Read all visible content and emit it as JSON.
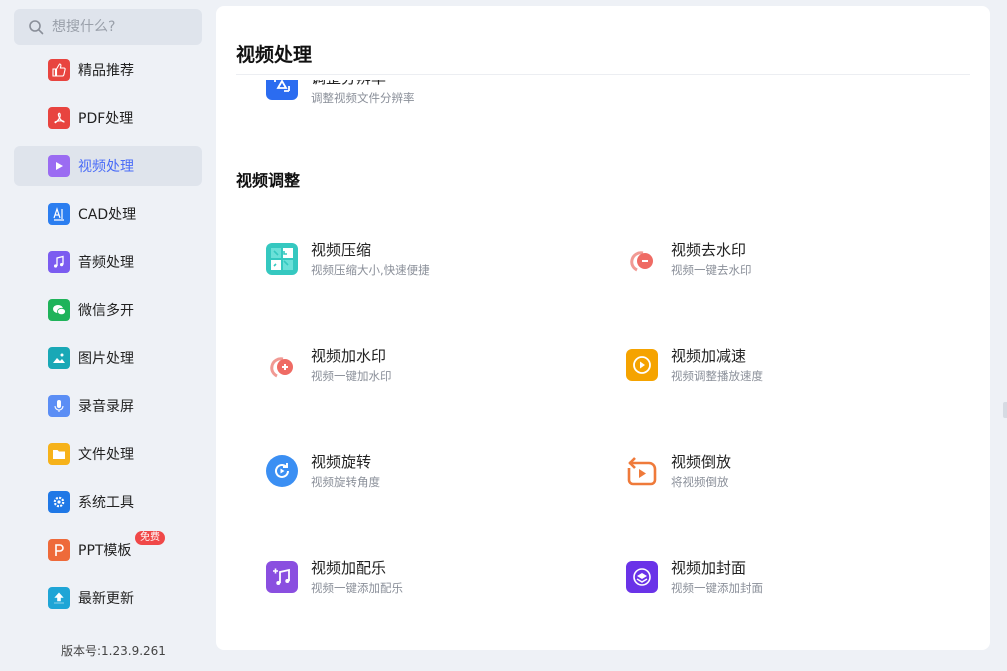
{
  "search": {
    "placeholder": "想搜什么?"
  },
  "sidebar": {
    "items": [
      {
        "label": "精品推荐",
        "icon": "thumbs-up-icon",
        "color": "#e8443f"
      },
      {
        "label": "PDF处理",
        "icon": "pdf-icon",
        "color": "#e8443f"
      },
      {
        "label": "视频处理",
        "icon": "play-icon",
        "color": "#9b6cf2"
      },
      {
        "label": "CAD处理",
        "icon": "cad-icon",
        "color": "#2b7ef0"
      },
      {
        "label": "音频处理",
        "icon": "music-icon",
        "color": "#7b5cf0"
      },
      {
        "label": "微信多开",
        "icon": "wechat-icon",
        "color": "#1fb35a"
      },
      {
        "label": "图片处理",
        "icon": "image-icon",
        "color": "#19a8b6"
      },
      {
        "label": "录音录屏",
        "icon": "microphone-icon",
        "color": "#5b8ef5"
      },
      {
        "label": "文件处理",
        "icon": "folder-icon",
        "color": "#f6b21a"
      },
      {
        "label": "系统工具",
        "icon": "gear-icon",
        "color": "#1f78e6"
      },
      {
        "label": "PPT模板",
        "icon": "ppt-icon",
        "color": "#ee6a3a",
        "badge": "免费"
      },
      {
        "label": "最新更新",
        "icon": "upload-icon",
        "color": "#1fa5d6"
      }
    ],
    "active_index": 2,
    "version": "版本号:1.23.9.261"
  },
  "main": {
    "title": "视频处理",
    "clipped_item": {
      "title": "调整分辨率",
      "desc": "调整视频文件分辨率",
      "icon": "resolution-icon",
      "color": "#2b6cf0"
    },
    "section_title": "视频调整",
    "tools": [
      {
        "title": "视频压缩",
        "desc": "视频压缩大小,快速便捷",
        "icon": "compress-icon",
        "color": "#35c8c0"
      },
      {
        "title": "视频去水印",
        "desc": "视频一键去水印",
        "icon": "remove-watermark-icon",
        "color": "#ef6b64"
      },
      {
        "title": "视频加水印",
        "desc": "视频一键加水印",
        "icon": "add-watermark-icon",
        "color": "#ef6b64"
      },
      {
        "title": "视频加减速",
        "desc": "视频调整播放速度",
        "icon": "speed-icon",
        "color": "#f5a300"
      },
      {
        "title": "视频旋转",
        "desc": "视频旋转角度",
        "icon": "rotate-icon",
        "color": "#3b8ff3"
      },
      {
        "title": "视频倒放",
        "desc": "将视频倒放",
        "icon": "reverse-icon",
        "color": "#ef7a3a"
      },
      {
        "title": "视频加配乐",
        "desc": "视频一键添加配乐",
        "icon": "add-music-icon",
        "color": "#8a4fe0"
      },
      {
        "title": "视频加封面",
        "desc": "视频一键添加封面",
        "icon": "add-cover-icon",
        "color": "#6a33e8"
      }
    ]
  }
}
